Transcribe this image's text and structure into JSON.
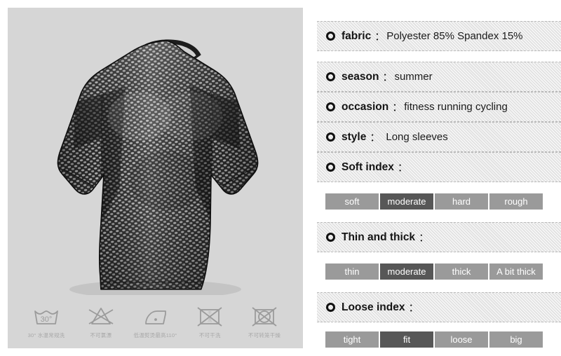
{
  "product": {
    "panel_name": "product-photo-panel",
    "garment": "black grey snake-scale pattern long sleeve compression shirt"
  },
  "care": {
    "items": [
      {
        "icon": "wash-30-degrees-icon",
        "caption": "30° 水温常规洗"
      },
      {
        "icon": "no-bleach-icon",
        "caption": "不可氯漂"
      },
      {
        "icon": "low-iron-110-icon",
        "caption": "低温熨烫最高110°"
      },
      {
        "icon": "no-dry-clean-icon",
        "caption": "不可干洗"
      },
      {
        "icon": "no-tumble-dry-icon",
        "caption": "不可转笼干燥"
      }
    ],
    "wash_temp_label": "30°"
  },
  "specs": [
    {
      "label": "fabric",
      "colon": "：",
      "value": "Polyester 85% Spandex 15%"
    },
    {
      "label": "season",
      "colon": "：",
      "value": "summer"
    },
    {
      "label": "occasion",
      "colon": "：",
      "value": "fitness running cycling"
    },
    {
      "label": "style",
      "colon": "：",
      "value": "Long sleeves"
    },
    {
      "label": "Soft index",
      "colon": "：",
      "value": ""
    },
    {
      "label": "Thin and thick",
      "colon": "：",
      "value": ""
    },
    {
      "label": "Loose index",
      "colon": "：",
      "value": ""
    }
  ],
  "scales": [
    {
      "name": "soft-index-scale",
      "options": [
        "soft",
        "moderate",
        "hard",
        "rough"
      ],
      "selected": "moderate"
    },
    {
      "name": "thin-thick-scale",
      "options": [
        "thin",
        "moderate",
        "thick",
        "A bit thick"
      ],
      "selected": "moderate"
    },
    {
      "name": "loose-index-scale",
      "options": [
        "tight",
        "fit",
        "loose",
        "big"
      ],
      "selected": "fit"
    }
  ],
  "colors": {
    "panel_bg": "#d6d6d6",
    "row_bg": "#f1f1f1",
    "row_border": "#b9b9b9",
    "scale_segment": "#9a9a9a",
    "scale_selected": "#575757",
    "care_icon": "#9b9b9b",
    "text": "#141414"
  }
}
